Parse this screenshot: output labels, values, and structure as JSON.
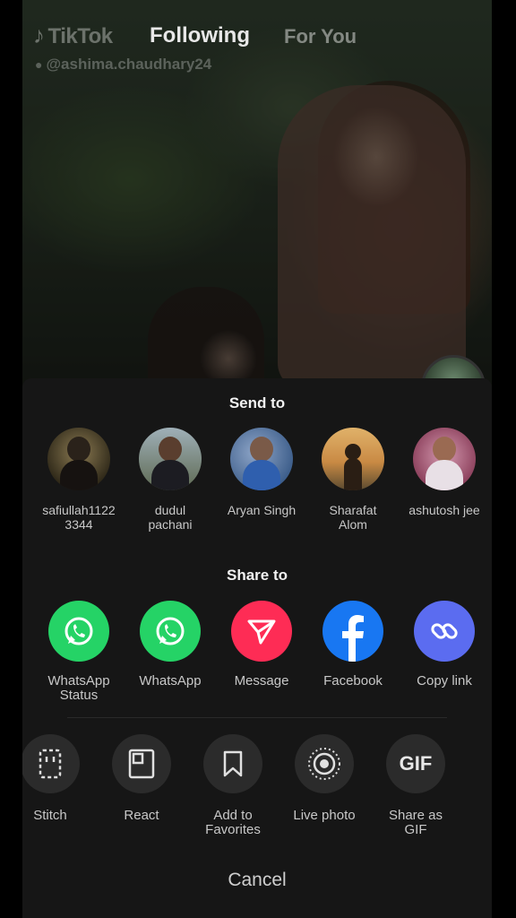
{
  "top": {
    "app_name": "TikTok",
    "tab_following": "Following",
    "tab_for_you": "For You",
    "username": "@ashima.chaudhary24"
  },
  "send_to": {
    "title": "Send to",
    "contacts": [
      {
        "line1": "safiullah1122",
        "line2": "3344"
      },
      {
        "line1": "dudul",
        "line2": "pachani"
      },
      {
        "line1": "Aryan Singh",
        "line2": ""
      },
      {
        "line1": "Sharafat",
        "line2": "Alom"
      },
      {
        "line1": "ashutosh jee",
        "line2": ""
      }
    ]
  },
  "share_to": {
    "title": "Share to",
    "apps": [
      {
        "line1": "WhatsApp",
        "line2": "Status",
        "icon": "whatsapp-icon",
        "color": "#25d366"
      },
      {
        "line1": "WhatsApp",
        "line2": "",
        "icon": "whatsapp-icon",
        "color": "#25d366"
      },
      {
        "line1": "Message",
        "line2": "",
        "icon": "send-icon",
        "color": "#fe2c55"
      },
      {
        "line1": "Facebook",
        "line2": "",
        "icon": "facebook-icon",
        "color": "#1877f2"
      },
      {
        "line1": "Copy link",
        "line2": "",
        "icon": "link-icon",
        "color": "#5b6cf0"
      }
    ]
  },
  "actions": [
    {
      "line1": "Stitch",
      "line2": "",
      "icon": "stitch-icon"
    },
    {
      "line1": "React",
      "line2": "",
      "icon": "react-icon"
    },
    {
      "line1": "Add to",
      "line2": "Favorites",
      "icon": "bookmark-icon"
    },
    {
      "line1": "Live photo",
      "line2": "",
      "icon": "live-photo-icon"
    },
    {
      "line1": "Share as",
      "line2": "GIF",
      "icon": "gif-icon",
      "icon_text": "GIF"
    }
  ],
  "cancel_label": "Cancel"
}
